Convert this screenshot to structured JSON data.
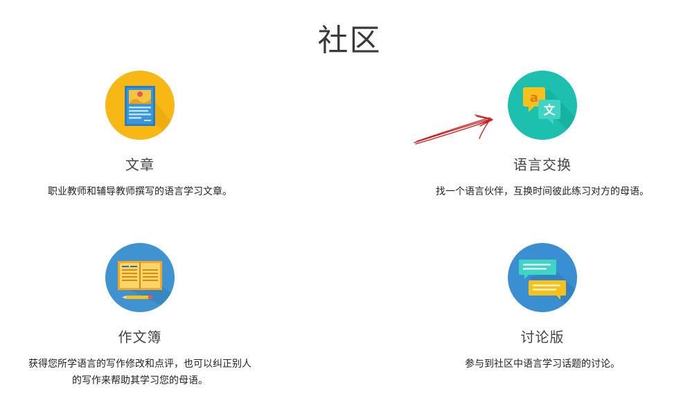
{
  "page": {
    "title": "社区"
  },
  "cards": [
    {
      "id": "articles",
      "icon": "article-document-icon",
      "title": "文章",
      "description": "职业教师和辅导教师撰写的语言学习文章。",
      "circle_color": "#F7B815"
    },
    {
      "id": "exchange",
      "icon": "language-translate-bubbles-icon",
      "title": "语言交换",
      "description": "找一个语言伙伴，互换时间彼此练习对方的母语。",
      "circle_color": "#1DBFAE"
    },
    {
      "id": "notebook",
      "icon": "open-notebook-pencil-icon",
      "title": "作文簿",
      "description": "获得您所学语言的写作修改和点评，也可以纠正别人的写作来帮助其学习您的母语。",
      "circle_color": "#3E93D0"
    },
    {
      "id": "forum",
      "icon": "chat-bubbles-icon",
      "title": "讨论版",
      "description": "参与到社区中语言学习话题的讨论。",
      "circle_color": "#3A8FD2"
    }
  ],
  "annotation": {
    "type": "hand-drawn-arrow",
    "color": "#CC1F1F",
    "points_to": "exchange"
  }
}
